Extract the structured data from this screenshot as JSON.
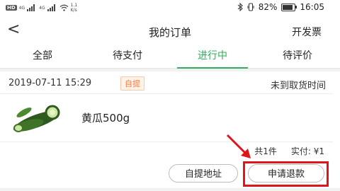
{
  "status_bar": {
    "hd_label": "HD",
    "network_left": "4G",
    "network_right": "4G",
    "speed": "1.1\nK/s",
    "battery_percent": 82,
    "battery_text": "82%",
    "time": "16:05"
  },
  "header": {
    "back_glyph": "<",
    "title": "我的订单",
    "action": "开发票"
  },
  "tabs": [
    {
      "label": "全部",
      "active": false
    },
    {
      "label": "待支付",
      "active": false
    },
    {
      "label": "进行中",
      "active": true
    },
    {
      "label": "待评价",
      "active": false
    }
  ],
  "order": {
    "datetime": "2019-07-11 15:29",
    "tag": "自提",
    "pickup_status": "未到取货时间",
    "product_name": "黄瓜500g",
    "product_image": "cucumber-image",
    "count_text": "共1件",
    "paid_label": "实付:",
    "paid_value": "¥1",
    "buttons": {
      "address": "自提地址",
      "refund": "申请退款"
    }
  },
  "colors": {
    "accent": "#2fae5b",
    "tag": "#f07c3a",
    "highlight": "#e0151b"
  }
}
